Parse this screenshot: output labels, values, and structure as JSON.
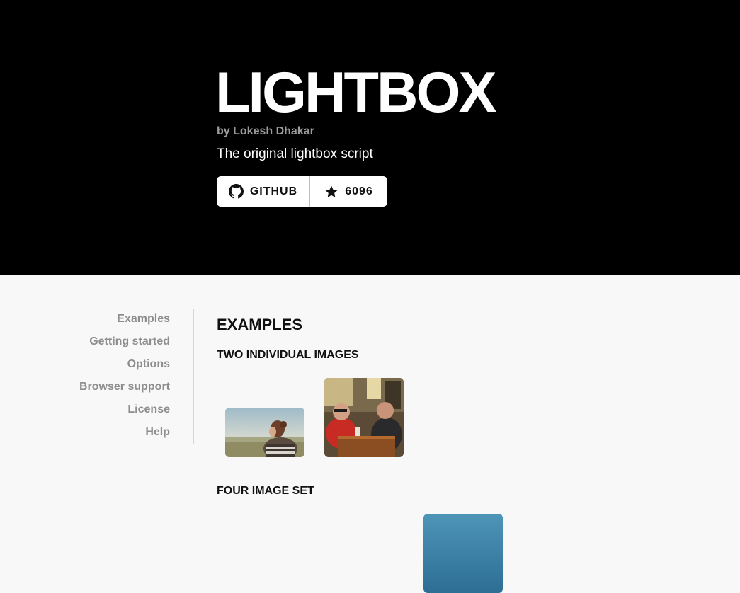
{
  "hero": {
    "title": "LIGHTBOX",
    "byline": "by Lokesh Dhakar",
    "tagline": "The original lightbox script",
    "github_label": "GITHUB",
    "stars_count": "6096"
  },
  "nav": {
    "items": [
      {
        "label": "Examples"
      },
      {
        "label": "Getting started"
      },
      {
        "label": "Options"
      },
      {
        "label": "Browser support"
      },
      {
        "label": "License"
      },
      {
        "label": "Help"
      }
    ]
  },
  "content": {
    "heading": "EXAMPLES",
    "section_two_images": "TWO INDIVIDUAL IMAGES",
    "section_four_images": "FOUR IMAGE SET"
  },
  "colors": {
    "hero_bg": "#000000",
    "page_bg": "#f8f8f8",
    "nav_text": "#8e8e8e",
    "byline": "#9c9c9c"
  },
  "icons": {
    "github": "github-icon",
    "star": "star-icon"
  }
}
